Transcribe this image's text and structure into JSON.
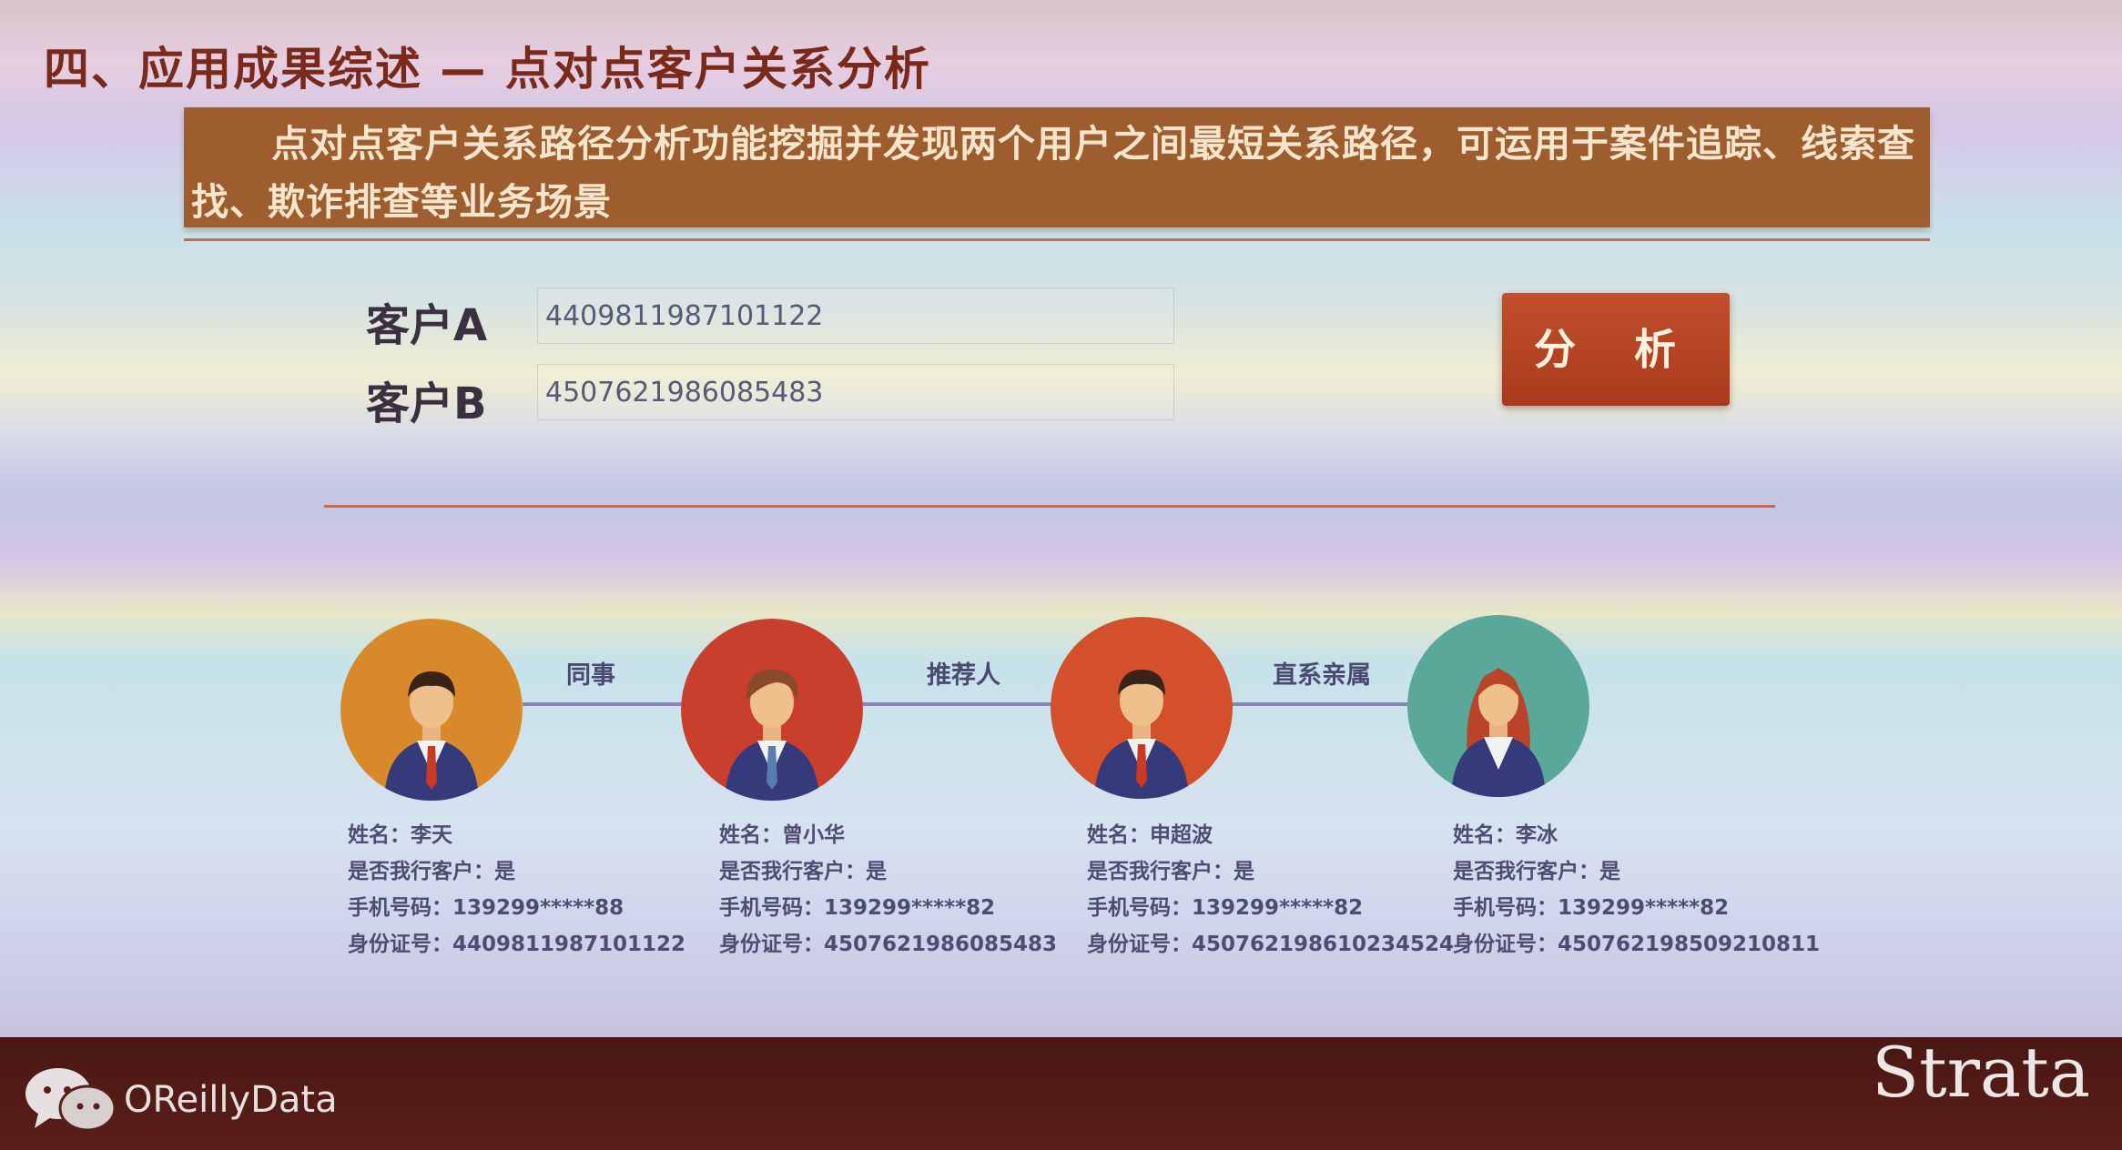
{
  "slide": {
    "title": "四、应用成果综述 — 点对点客户关系分析",
    "banner_text": "点对点客户关系路径分析功能挖掘并发现两个用户之间最短关系路径，可运用于案件追踪、线索查找、欺诈排查等业务场景"
  },
  "form": {
    "client_a_label": "客户A",
    "client_a_value": "440981198710112​2",
    "client_b_label": "客户B",
    "client_b_value": "4507621986085483",
    "analyze_button": "分 析"
  },
  "path": {
    "relations": [
      "同事",
      "推荐人",
      "直系亲属"
    ],
    "people": [
      {
        "avatar_color": "#d88a2a",
        "gender": "male",
        "name": "姓名：李天",
        "is_customer": "是否我行客户：是",
        "phone": "手机号码：139299*****88",
        "id_number": "身份证号：4409811987101122"
      },
      {
        "avatar_color": "#c8402c",
        "gender": "male",
        "name": "姓名：曾小华",
        "is_customer": "是否我行客户：是",
        "phone": "手机号码：139299*****82",
        "id_number": "身份证号：4507621986085483"
      },
      {
        "avatar_color": "#d4502a",
        "gender": "male",
        "name": "姓名：申超波",
        "is_customer": "是否我行客户：是",
        "phone": "手机号码：139299*****82",
        "id_number": "身份证号：450762198610234524"
      },
      {
        "avatar_color": "#5aa89a",
        "gender": "female",
        "name": "姓名：李冰",
        "is_customer": "是否我行客户：是",
        "phone": "手机号码：139299*****82",
        "id_number": "身份证号：450762198509210811"
      }
    ]
  },
  "footer": {
    "brand": "OReillyData",
    "logo": "Strata"
  }
}
